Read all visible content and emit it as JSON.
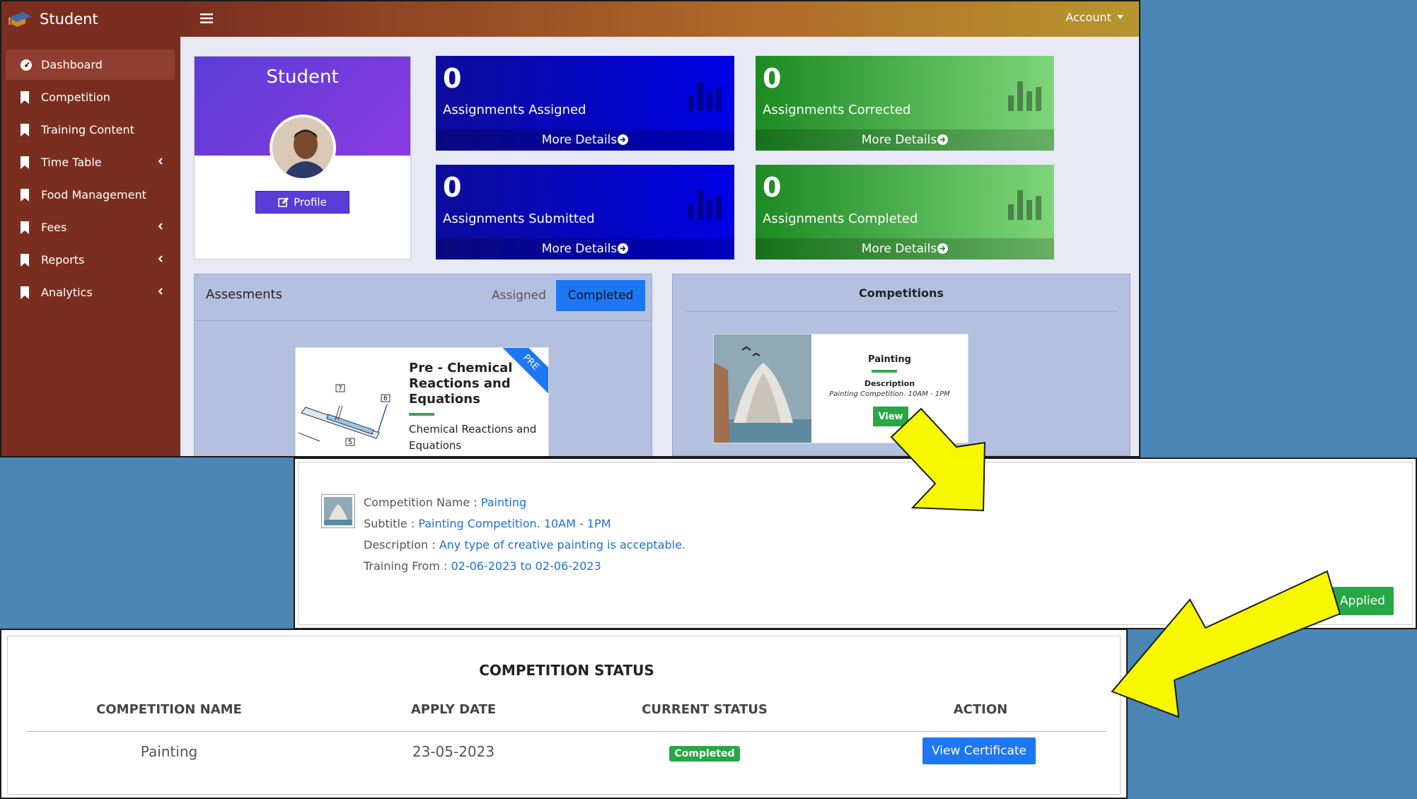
{
  "brand": {
    "name": "Student"
  },
  "sidebar": {
    "items": [
      {
        "label": "Dashboard"
      },
      {
        "label": "Competition"
      },
      {
        "label": "Training Content"
      },
      {
        "label": "Time Table"
      },
      {
        "label": "Food Management"
      },
      {
        "label": "Fees"
      },
      {
        "label": "Reports"
      },
      {
        "label": "Analytics"
      }
    ]
  },
  "topbar": {
    "account_label": "Account"
  },
  "profile": {
    "title": "Student",
    "button_label": "Profile"
  },
  "stats": [
    {
      "value": "0",
      "label": "Assignments Assigned",
      "more": "More Details"
    },
    {
      "value": "0",
      "label": "Assignments Corrected",
      "more": "More Details"
    },
    {
      "value": "0",
      "label": "Assignments Submitted",
      "more": "More Details"
    },
    {
      "value": "0",
      "label": "Assignments Completed",
      "more": "More Details"
    }
  ],
  "assessments": {
    "title": "Assesments",
    "tabs": [
      "Assigned",
      "Completed"
    ],
    "card": {
      "title": "Pre - Chemical Reactions and Equations",
      "description": "Chemical Reactions and Equations",
      "ribbon": "PRE",
      "diagram_labels": [
        "7",
        "6",
        "5"
      ]
    }
  },
  "competitions": {
    "title": "Competitions",
    "card": {
      "name": "Painting",
      "desc_label": "Description",
      "subtitle": "Painting Competition. 10AM - 1PM",
      "view_label": "View"
    }
  },
  "detail": {
    "rows": [
      {
        "label": "Competition Name :",
        "value": "Painting"
      },
      {
        "label": "Subtitle :",
        "value": "Painting Competition. 10AM - 1PM"
      },
      {
        "label": "Description :",
        "value": "Any type of creative painting is acceptable."
      },
      {
        "label": "Training From :",
        "value": "02-06-2023 to 02-06-2023"
      }
    ],
    "status_button": "Applied"
  },
  "status_table": {
    "title": "COMPETITION STATUS",
    "columns": [
      "COMPETITION NAME",
      "APPLY DATE",
      "CURRENT STATUS",
      "ACTION"
    ],
    "rows": [
      {
        "name": "Painting",
        "apply_date": "23-05-2023",
        "status": "Completed",
        "action": "View Certificate"
      }
    ]
  },
  "colors": {
    "sidebar": "#7a2e20",
    "primary_blue": "#1e77f2",
    "success_green": "#28a745",
    "highlight_arrow": "#f7f700"
  }
}
